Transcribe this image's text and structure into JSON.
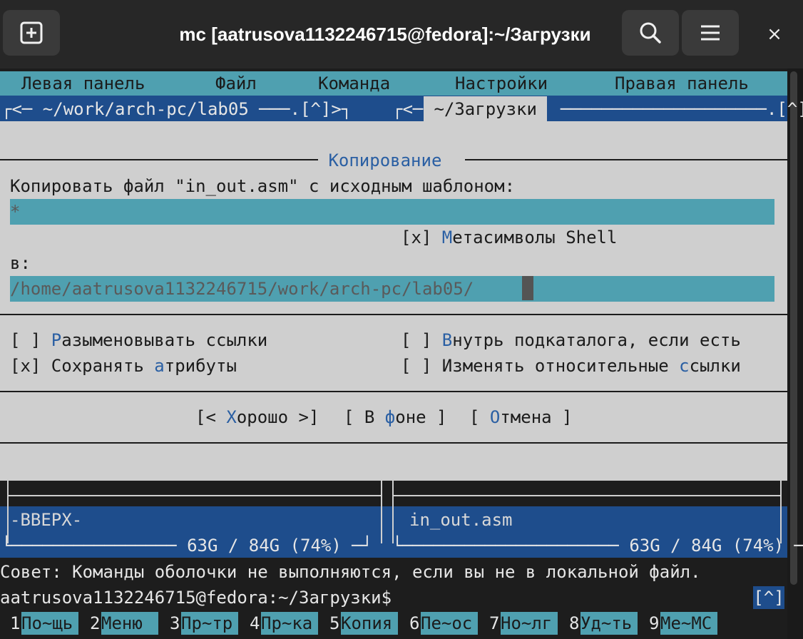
{
  "window": {
    "title": "mc [aatrusova1132246715@fedora]:~/Загрузки",
    "close_glyph": "×"
  },
  "menu": {
    "items": [
      "Левая панель",
      "Файл",
      "Команда",
      "Настройки",
      "Правая панель"
    ]
  },
  "panels": {
    "left_header": "┌<─ ~/work/arch-pc/lab05 ───.[^]>┐",
    "right_header_prefix": "┌<─ ",
    "right_header_path": " ~/Загрузки ",
    "right_header_suffix": "────────────────────.[^]>┐",
    "left_entry": "-ВВЕРХ-",
    "right_entry": "in_out.asm",
    "left_footer": "└──────────────── 63G / 84G (74%) ─┘",
    "right_footer": "└───────────────────── 63G / 84G (74%) ─┘"
  },
  "dialog": {
    "title": " Копирование ",
    "prompt": "Копировать файл \"in_out.asm\" с исходным шаблоном:",
    "source_value": "*",
    "shell_checkbox": "[x] ",
    "shell_hot": "М",
    "shell_rest": "етасимволы Shell",
    "to_label": "в:",
    "dest_value": "/home/aatrusova1132246715/work/arch-pc/lab05/",
    "opt1_box": "[ ] ",
    "opt1_hot": "Р",
    "opt1_rest": "азыменовывать ссылки",
    "opt2_box": "[x] ",
    "opt2_pre": "Сохранять ",
    "opt2_hot": "а",
    "opt2_rest": "трибуты",
    "opt3_box": "[ ] ",
    "opt3_hot": "В",
    "opt3_rest": "нутрь подкаталога, если есть",
    "opt4_box": "[ ] ",
    "opt4_pre": "Изменять относительные ",
    "opt4_hot": "с",
    "opt4_rest": "сылки",
    "btn_ok_pre": "[< ",
    "btn_ok_hot": "Х",
    "btn_ok_rest": "орошо >]",
    "btn_bg_pre": "[ В ",
    "btn_bg_hot": "ф",
    "btn_bg_rest": "оне ]",
    "btn_cancel_pre": "[ ",
    "btn_cancel_hot": "О",
    "btn_cancel_rest": "тмена ]"
  },
  "tip": "Совет: Команды оболочки не выполняются, если вы не в локальной файл.",
  "prompt": "aatrusova1132246715@fedora:~/Загрузки$",
  "prompt_badge": "[^]",
  "fkeys": [
    {
      "num": "1",
      "label": "По~щь"
    },
    {
      "num": "2",
      "label": "Меню "
    },
    {
      "num": "3",
      "label": "Пр~тр"
    },
    {
      "num": "4",
      "label": "Пр~ка"
    },
    {
      "num": "5",
      "label": "Копия"
    },
    {
      "num": "6",
      "label": "Пе~ос"
    },
    {
      "num": "7",
      "label": "Но~лг"
    },
    {
      "num": "8",
      "label": "Уд~ть"
    },
    {
      "num": "9",
      "label": "Ме~МС"
    }
  ],
  "colors": {
    "menu_bg": "#4fa0b0",
    "panel_bg": "#1e4d8c",
    "dialog_bg": "#cfcfcf",
    "hotkey": "#2a5fa3"
  }
}
